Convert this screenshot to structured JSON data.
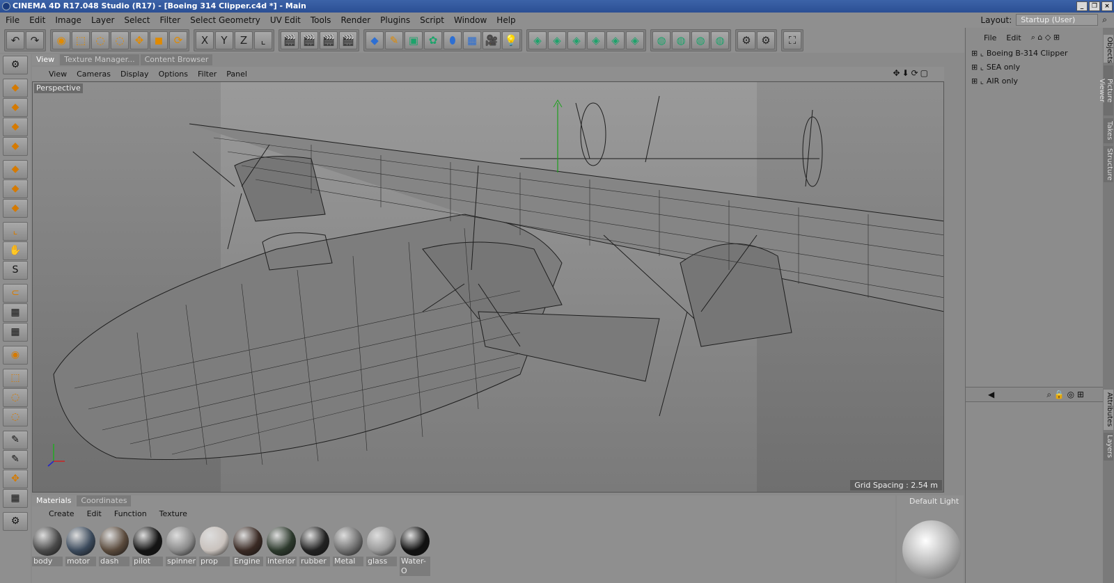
{
  "window": {
    "title": "CINEMA 4D R17.048 Studio (R17) - [Boeing 314 Clipper.c4d *] - Main",
    "buttons": [
      "_",
      "❐",
      "×"
    ]
  },
  "menu": [
    "File",
    "Edit",
    "Image",
    "Layer",
    "Select",
    "Filter",
    "Select Geometry",
    "UV Edit",
    "Tools",
    "Render",
    "Plugins",
    "Script",
    "Window",
    "Help"
  ],
  "layout": {
    "label": "Layout:",
    "value": "Startup (User)"
  },
  "toolbar": {
    "groups": [
      [
        {
          "icon": "undo-icon",
          "glyph": "↶"
        },
        {
          "icon": "redo-icon",
          "glyph": "↷"
        }
      ],
      [
        {
          "icon": "live-selection-icon",
          "glyph": "◉",
          "c": "o"
        },
        {
          "icon": "rect-selection-icon",
          "glyph": "⬚",
          "c": "o"
        },
        {
          "icon": "lasso-selection-icon",
          "glyph": "◌",
          "c": "o"
        },
        {
          "icon": "poly-selection-icon",
          "glyph": "◌",
          "c": "o"
        },
        {
          "icon": "move-icon",
          "glyph": "✥",
          "c": "o"
        },
        {
          "icon": "scale-icon",
          "glyph": "◼",
          "c": "o"
        },
        {
          "icon": "rotate-icon",
          "glyph": "⟳",
          "c": "o"
        }
      ],
      [
        {
          "icon": "x-axis-icon",
          "glyph": "X"
        },
        {
          "icon": "y-axis-icon",
          "glyph": "Y"
        },
        {
          "icon": "z-axis-icon",
          "glyph": "Z"
        },
        {
          "icon": "coord-system-icon",
          "glyph": "⌞"
        }
      ],
      [
        {
          "icon": "render-view-icon",
          "glyph": "🎬"
        },
        {
          "icon": "render-picture-viewer-icon",
          "glyph": "🎬"
        },
        {
          "icon": "render-settings-icon",
          "glyph": "🎬"
        },
        {
          "icon": "edit-render-settings-icon",
          "glyph": "🎬"
        }
      ],
      [
        {
          "icon": "cube-icon",
          "glyph": "◆",
          "c": "b"
        },
        {
          "icon": "pen-spline-icon",
          "glyph": "✎",
          "c": "o"
        },
        {
          "icon": "subdivision-icon",
          "glyph": "▣",
          "c": "c"
        },
        {
          "icon": "array-icon",
          "glyph": "✿",
          "c": "c"
        },
        {
          "icon": "bend-deformer-icon",
          "glyph": "⬮",
          "c": "b"
        },
        {
          "icon": "floor-icon",
          "glyph": "▦",
          "c": "b"
        },
        {
          "icon": "camera-icon",
          "glyph": "🎥"
        },
        {
          "icon": "light-icon",
          "glyph": "💡"
        }
      ],
      [
        {
          "icon": "points-mode-icon",
          "glyph": "◈",
          "c": "c"
        },
        {
          "icon": "edges-mode-icon",
          "glyph": "◈",
          "c": "c"
        },
        {
          "icon": "polygons-mode-icon",
          "glyph": "◈",
          "c": "c"
        },
        {
          "icon": "model-mode-icon",
          "glyph": "◈",
          "c": "c"
        },
        {
          "icon": "texture-mode-icon",
          "glyph": "◈",
          "c": "c"
        },
        {
          "icon": "workplane-mode-icon",
          "glyph": "◈",
          "c": "c"
        }
      ],
      [
        {
          "icon": "spline-mode-icon",
          "glyph": "◍",
          "c": "c"
        },
        {
          "icon": "boolean-icon",
          "glyph": "◍",
          "c": "c"
        },
        {
          "icon": "symmetry-icon",
          "glyph": "◍",
          "c": "c"
        },
        {
          "icon": "metaball-icon",
          "glyph": "◍",
          "c": "c"
        }
      ],
      [
        {
          "icon": "snap-icon",
          "glyph": "⚙"
        },
        {
          "icon": "snap-settings-icon",
          "glyph": "⚙"
        }
      ],
      [
        {
          "icon": "fullscreen-icon",
          "glyph": "⛶"
        }
      ]
    ]
  },
  "left_tools": [
    {
      "icon": "make-editable-icon",
      "glyph": "⚙"
    },
    {
      "icon": "model-mode-icon",
      "glyph": "◆",
      "c": "o"
    },
    {
      "icon": "texture-mode-icon",
      "glyph": "◆",
      "c": "o"
    },
    {
      "icon": "workplane-icon",
      "glyph": "◆",
      "c": "o"
    },
    {
      "icon": "floor-tool-icon",
      "glyph": "◆",
      "c": "o"
    },
    {
      "icon": "points-tool-icon",
      "glyph": "◆",
      "c": "o"
    },
    {
      "icon": "edges-tool-icon",
      "glyph": "◆",
      "c": "o"
    },
    {
      "icon": "polygons-tool-icon",
      "glyph": "◆",
      "c": "o"
    },
    {
      "icon": "axis-icon",
      "glyph": "⌞",
      "c": "o"
    },
    {
      "icon": "tweak-icon",
      "glyph": "✋",
      "c": "o"
    },
    {
      "icon": "solo-icon",
      "glyph": "S"
    },
    {
      "icon": "magnet-icon",
      "glyph": "⊂",
      "c": "o"
    },
    {
      "icon": "checker-icon",
      "glyph": "▦"
    },
    {
      "icon": "checker-2-icon",
      "glyph": "▦"
    },
    {
      "icon": "live-select-icon",
      "glyph": "◉",
      "c": "o"
    },
    {
      "icon": "rect-select-icon",
      "glyph": "⬚",
      "c": "o"
    },
    {
      "icon": "lasso-select-icon",
      "glyph": "◌",
      "c": "o"
    },
    {
      "icon": "poly-select-icon",
      "glyph": "◌",
      "c": "o"
    },
    {
      "icon": "brush-icon",
      "glyph": "✎"
    },
    {
      "icon": "dropper-icon",
      "glyph": "✎"
    },
    {
      "icon": "move-icon",
      "glyph": "✥",
      "c": "o"
    },
    {
      "icon": "grid-icon",
      "glyph": "▦"
    },
    {
      "icon": "sculpt-icon",
      "glyph": "⚙"
    }
  ],
  "viewport": {
    "tabs": [
      "View",
      "Texture Manager...",
      "Content Browser"
    ],
    "menu": [
      "View",
      "Cameras",
      "Display",
      "Options",
      "Filter",
      "Panel"
    ],
    "camera": "Perspective",
    "grid_spacing": "Grid Spacing : 2.54 m"
  },
  "materials": {
    "tabs": [
      "Materials",
      "Coordinates"
    ],
    "menu": [
      "Create",
      "Edit",
      "Function",
      "Texture"
    ],
    "items": [
      {
        "name": "body",
        "color": "#4a4a4a"
      },
      {
        "name": "motor",
        "color": "#3b4a5c"
      },
      {
        "name": "dash",
        "color": "#5a4a3c"
      },
      {
        "name": "pilot",
        "color": "#151515"
      },
      {
        "name": "spinner",
        "color": "#8a8a8a"
      },
      {
        "name": "prop",
        "color": "#c9c2bd"
      },
      {
        "name": "Engine",
        "color": "#3a2a24"
      },
      {
        "name": "interior",
        "color": "#2d3a2d"
      },
      {
        "name": "rubber",
        "color": "#222222"
      },
      {
        "name": "Metal",
        "color": "#6f6f6f"
      },
      {
        "name": "glass",
        "color": "#9a9a9a"
      },
      {
        "name": "Water-O",
        "color": "#111111"
      }
    ]
  },
  "objects": {
    "menu": [
      "File",
      "Edit"
    ],
    "items": [
      "Boeing B-314 Clipper",
      "SEA only",
      "AIR only"
    ]
  },
  "side_tabs": [
    "Objects",
    "Picture Viewer",
    "Takes",
    "Structure",
    "Attributes",
    "Layers"
  ],
  "preview": {
    "label": "Default Light"
  }
}
